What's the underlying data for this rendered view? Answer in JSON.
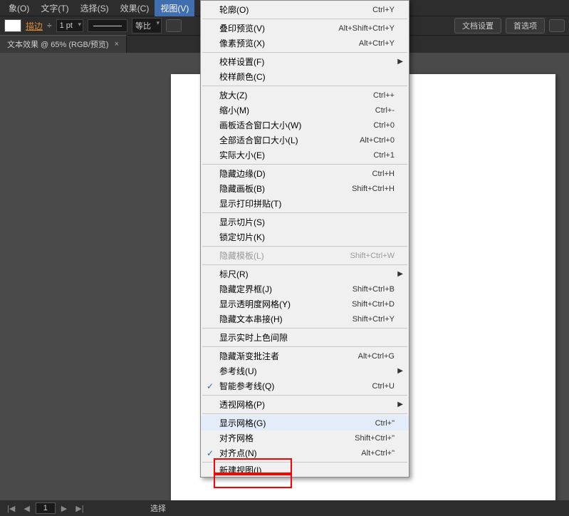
{
  "menubar": {
    "items": [
      "象(O)",
      "文字(T)",
      "选择(S)",
      "效果(C)",
      "视图(V)"
    ],
    "active_index": 4
  },
  "toolbar": {
    "stroke_label": "描边",
    "stroke_width": "1 pt",
    "dash_label": "等比",
    "doc_setup": "文档设置",
    "prefs": "首选项"
  },
  "tab": {
    "title": "文本效果 @ 65% (RGB/预览)"
  },
  "menu": {
    "outline": {
      "label": "轮廓(O)",
      "sc": "Ctrl+Y"
    },
    "overprint": {
      "label": "叠印预览(V)",
      "sc": "Alt+Shift+Ctrl+Y"
    },
    "pixel": {
      "label": "像素预览(X)",
      "sc": "Alt+Ctrl+Y"
    },
    "proof_setup": {
      "label": "校样设置(F)"
    },
    "proof_colors": {
      "label": "校样颜色(C)"
    },
    "zoom_in": {
      "label": "放大(Z)",
      "sc": "Ctrl++"
    },
    "zoom_out": {
      "label": "缩小(M)",
      "sc": "Ctrl+-"
    },
    "fit_artboard": {
      "label": "画板适合窗口大小(W)",
      "sc": "Ctrl+0"
    },
    "fit_all": {
      "label": "全部适合窗口大小(L)",
      "sc": "Alt+Ctrl+0"
    },
    "actual_size": {
      "label": "实际大小(E)",
      "sc": "Ctrl+1"
    },
    "hide_edges": {
      "label": "隐藏边缘(D)",
      "sc": "Ctrl+H"
    },
    "hide_artboards": {
      "label": "隐藏画板(B)",
      "sc": "Shift+Ctrl+H"
    },
    "show_print_tiling": {
      "label": "显示打印拼贴(T)"
    },
    "show_slices": {
      "label": "显示切片(S)"
    },
    "lock_slices": {
      "label": "锁定切片(K)"
    },
    "hide_template": {
      "label": "隐藏模板(L)",
      "sc": "Shift+Ctrl+W"
    },
    "rulers": {
      "label": "标尺(R)"
    },
    "hide_bbox": {
      "label": "隐藏定界框(J)",
      "sc": "Shift+Ctrl+B"
    },
    "show_transparency_grid": {
      "label": "显示透明度网格(Y)",
      "sc": "Shift+Ctrl+D"
    },
    "hide_text_threads": {
      "label": "隐藏文本串接(H)",
      "sc": "Shift+Ctrl+Y"
    },
    "show_live_paint_gaps": {
      "label": "显示实时上色间隙"
    },
    "hide_gradient_annotator": {
      "label": "隐藏渐变批注者",
      "sc": "Alt+Ctrl+G"
    },
    "guides": {
      "label": "参考线(U)"
    },
    "smart_guides": {
      "label": "智能参考线(Q)",
      "sc": "Ctrl+U"
    },
    "perspective_grid": {
      "label": "透视网格(P)"
    },
    "show_grid": {
      "label": "显示网格(G)",
      "sc": "Ctrl+\""
    },
    "snap_to_grid": {
      "label": "对齐网格",
      "sc": "Shift+Ctrl+\""
    },
    "snap_to_point": {
      "label": "对齐点(N)",
      "sc": "Alt+Ctrl+\""
    },
    "new_view": {
      "label": "新建视图(I)"
    }
  },
  "statusbar": {
    "page": "1",
    "sel_label": "选择"
  }
}
